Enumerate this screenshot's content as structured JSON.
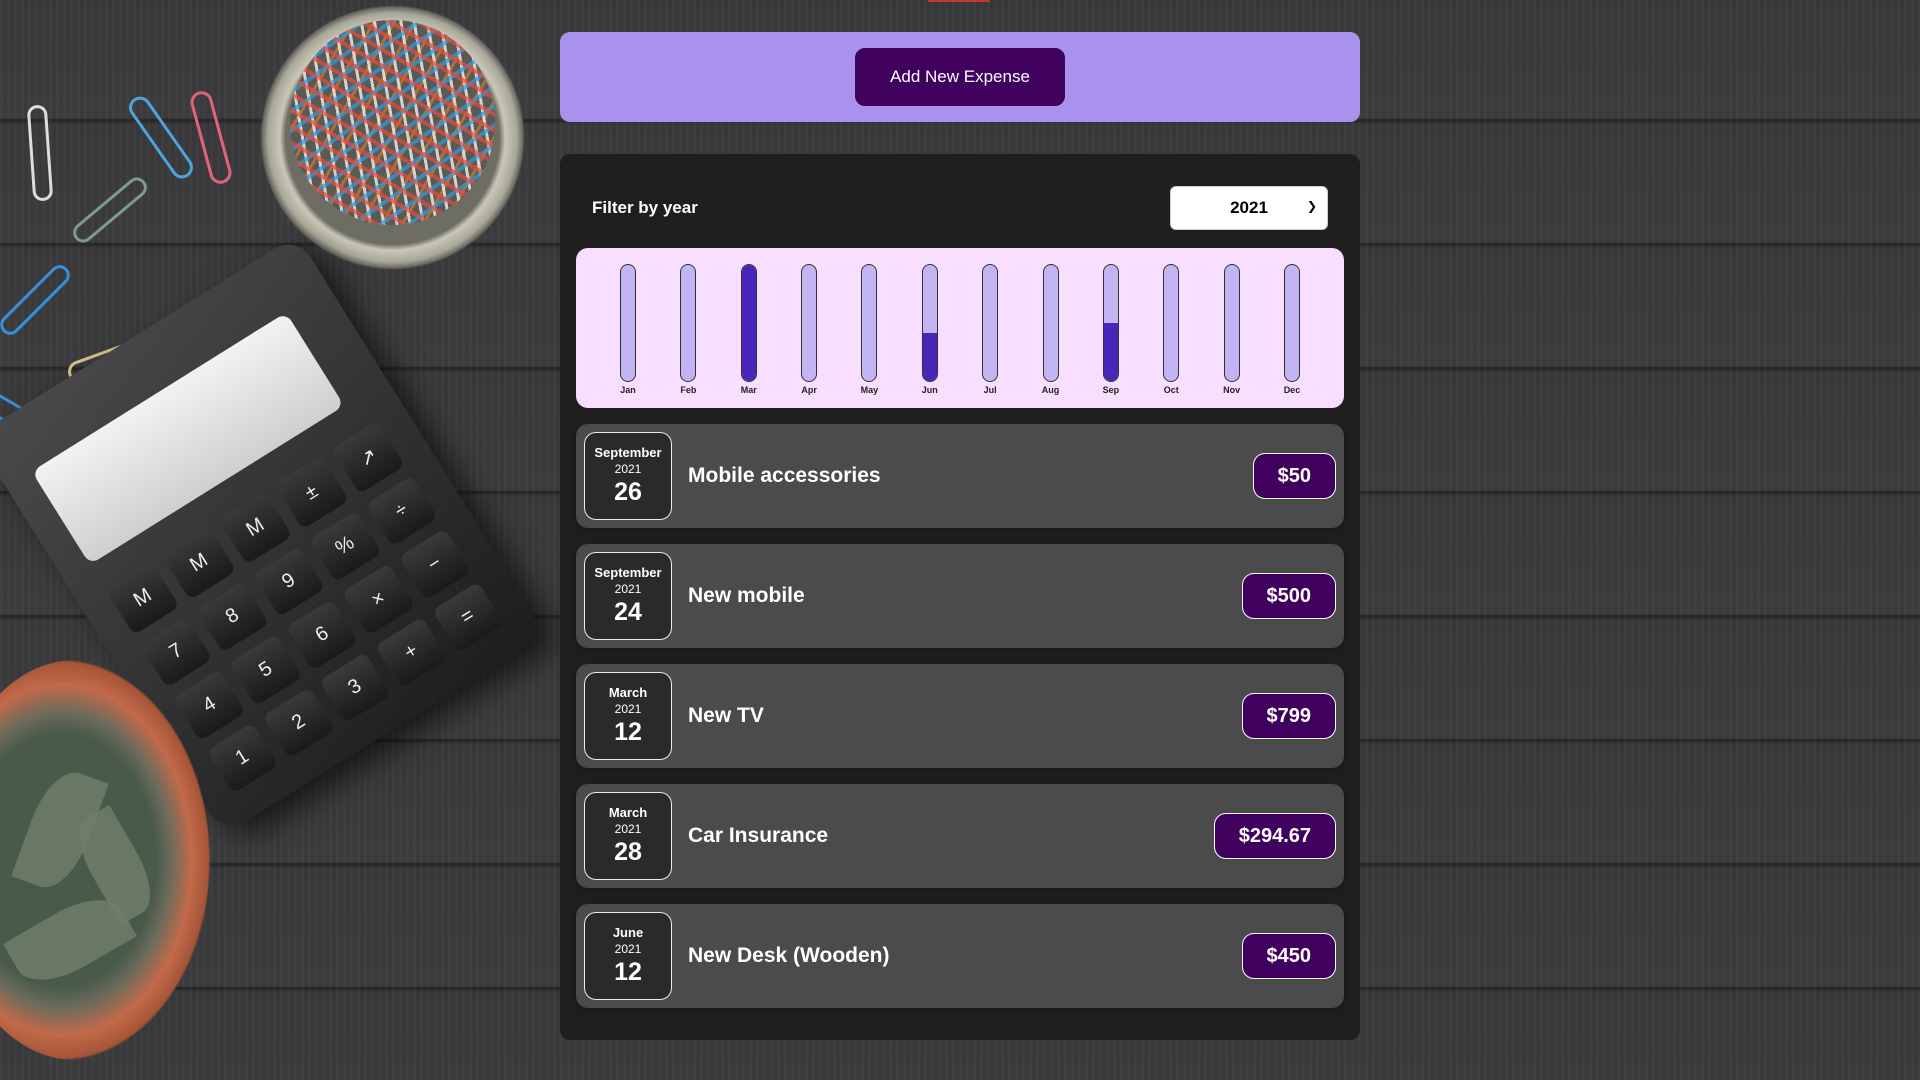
{
  "new_expense": {
    "button_label": "Add New Expense"
  },
  "filter": {
    "label": "Filter by year",
    "selected_year": "2021"
  },
  "chart_data": {
    "type": "bar",
    "categories": [
      "Jan",
      "Feb",
      "Mar",
      "Apr",
      "May",
      "Jun",
      "Jul",
      "Aug",
      "Sep",
      "Oct",
      "Nov",
      "Dec"
    ],
    "values": [
      0,
      0,
      1093.67,
      0,
      0,
      450,
      0,
      0,
      550,
      0,
      0,
      0
    ],
    "ylim": [
      0,
      1093.67
    ]
  },
  "expenses": [
    {
      "month": "September",
      "year": "2021",
      "day": "26",
      "title": "Mobile accessories",
      "amount": "$50"
    },
    {
      "month": "September",
      "year": "2021",
      "day": "24",
      "title": "New mobile",
      "amount": "$500"
    },
    {
      "month": "March",
      "year": "2021",
      "day": "12",
      "title": "New TV",
      "amount": "$799"
    },
    {
      "month": "March",
      "year": "2021",
      "day": "28",
      "title": "Car Insurance",
      "amount": "$294.67"
    },
    {
      "month": "June",
      "year": "2021",
      "day": "12",
      "title": "New Desk (Wooden)",
      "amount": "$450"
    }
  ],
  "colors": {
    "accent": "#40005d",
    "header_bg": "#a892ee",
    "chart_bg": "#f8dfff",
    "bar_fill": "#4826b9"
  },
  "icons": {
    "select_arrow": "chevron-down-icon"
  }
}
